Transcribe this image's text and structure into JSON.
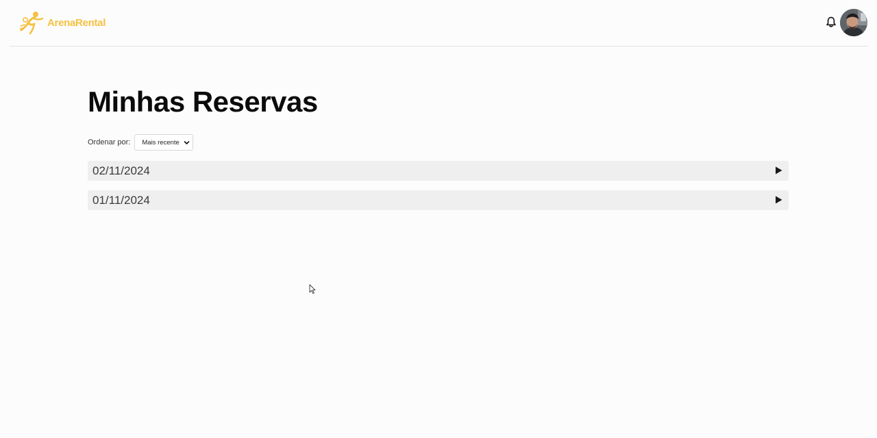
{
  "brand": {
    "name": "ArenaRental",
    "color": "#f6c143"
  },
  "header": {
    "notifications_icon": "bell-icon",
    "avatar_icon": "user-avatar"
  },
  "main": {
    "title": "Minhas Reservas",
    "sort": {
      "label": "Ordenar por:",
      "selected": "Mais recente"
    },
    "reservations": [
      {
        "date": "02/11/2024",
        "icon": "play-arrow-icon"
      },
      {
        "date": "01/11/2024",
        "icon": "play-arrow-icon"
      }
    ]
  }
}
